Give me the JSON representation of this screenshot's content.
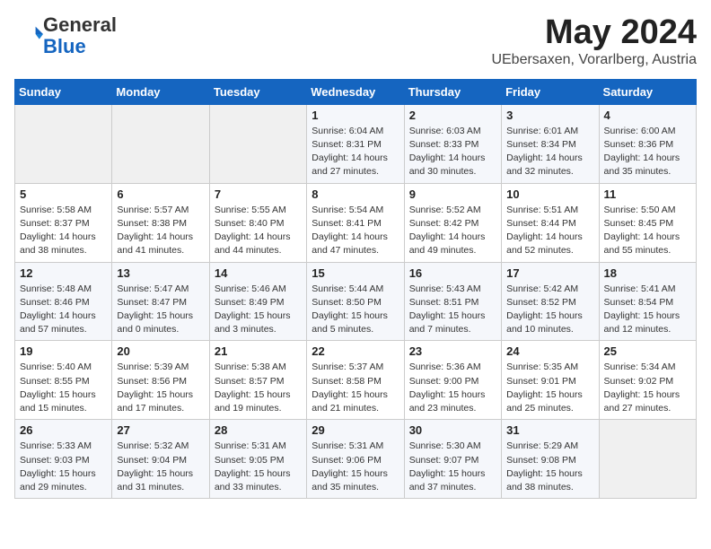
{
  "logo": {
    "general": "General",
    "blue": "Blue"
  },
  "title": "May 2024",
  "subtitle": "UEbersaxen, Vorarlberg, Austria",
  "days_of_week": [
    "Sunday",
    "Monday",
    "Tuesday",
    "Wednesday",
    "Thursday",
    "Friday",
    "Saturday"
  ],
  "weeks": [
    [
      {
        "day": "",
        "info": ""
      },
      {
        "day": "",
        "info": ""
      },
      {
        "day": "",
        "info": ""
      },
      {
        "day": "1",
        "info": "Sunrise: 6:04 AM\nSunset: 8:31 PM\nDaylight: 14 hours and 27 minutes."
      },
      {
        "day": "2",
        "info": "Sunrise: 6:03 AM\nSunset: 8:33 PM\nDaylight: 14 hours and 30 minutes."
      },
      {
        "day": "3",
        "info": "Sunrise: 6:01 AM\nSunset: 8:34 PM\nDaylight: 14 hours and 32 minutes."
      },
      {
        "day": "4",
        "info": "Sunrise: 6:00 AM\nSunset: 8:36 PM\nDaylight: 14 hours and 35 minutes."
      }
    ],
    [
      {
        "day": "5",
        "info": "Sunrise: 5:58 AM\nSunset: 8:37 PM\nDaylight: 14 hours and 38 minutes."
      },
      {
        "day": "6",
        "info": "Sunrise: 5:57 AM\nSunset: 8:38 PM\nDaylight: 14 hours and 41 minutes."
      },
      {
        "day": "7",
        "info": "Sunrise: 5:55 AM\nSunset: 8:40 PM\nDaylight: 14 hours and 44 minutes."
      },
      {
        "day": "8",
        "info": "Sunrise: 5:54 AM\nSunset: 8:41 PM\nDaylight: 14 hours and 47 minutes."
      },
      {
        "day": "9",
        "info": "Sunrise: 5:52 AM\nSunset: 8:42 PM\nDaylight: 14 hours and 49 minutes."
      },
      {
        "day": "10",
        "info": "Sunrise: 5:51 AM\nSunset: 8:44 PM\nDaylight: 14 hours and 52 minutes."
      },
      {
        "day": "11",
        "info": "Sunrise: 5:50 AM\nSunset: 8:45 PM\nDaylight: 14 hours and 55 minutes."
      }
    ],
    [
      {
        "day": "12",
        "info": "Sunrise: 5:48 AM\nSunset: 8:46 PM\nDaylight: 14 hours and 57 minutes."
      },
      {
        "day": "13",
        "info": "Sunrise: 5:47 AM\nSunset: 8:47 PM\nDaylight: 15 hours and 0 minutes."
      },
      {
        "day": "14",
        "info": "Sunrise: 5:46 AM\nSunset: 8:49 PM\nDaylight: 15 hours and 3 minutes."
      },
      {
        "day": "15",
        "info": "Sunrise: 5:44 AM\nSunset: 8:50 PM\nDaylight: 15 hours and 5 minutes."
      },
      {
        "day": "16",
        "info": "Sunrise: 5:43 AM\nSunset: 8:51 PM\nDaylight: 15 hours and 7 minutes."
      },
      {
        "day": "17",
        "info": "Sunrise: 5:42 AM\nSunset: 8:52 PM\nDaylight: 15 hours and 10 minutes."
      },
      {
        "day": "18",
        "info": "Sunrise: 5:41 AM\nSunset: 8:54 PM\nDaylight: 15 hours and 12 minutes."
      }
    ],
    [
      {
        "day": "19",
        "info": "Sunrise: 5:40 AM\nSunset: 8:55 PM\nDaylight: 15 hours and 15 minutes."
      },
      {
        "day": "20",
        "info": "Sunrise: 5:39 AM\nSunset: 8:56 PM\nDaylight: 15 hours and 17 minutes."
      },
      {
        "day": "21",
        "info": "Sunrise: 5:38 AM\nSunset: 8:57 PM\nDaylight: 15 hours and 19 minutes."
      },
      {
        "day": "22",
        "info": "Sunrise: 5:37 AM\nSunset: 8:58 PM\nDaylight: 15 hours and 21 minutes."
      },
      {
        "day": "23",
        "info": "Sunrise: 5:36 AM\nSunset: 9:00 PM\nDaylight: 15 hours and 23 minutes."
      },
      {
        "day": "24",
        "info": "Sunrise: 5:35 AM\nSunset: 9:01 PM\nDaylight: 15 hours and 25 minutes."
      },
      {
        "day": "25",
        "info": "Sunrise: 5:34 AM\nSunset: 9:02 PM\nDaylight: 15 hours and 27 minutes."
      }
    ],
    [
      {
        "day": "26",
        "info": "Sunrise: 5:33 AM\nSunset: 9:03 PM\nDaylight: 15 hours and 29 minutes."
      },
      {
        "day": "27",
        "info": "Sunrise: 5:32 AM\nSunset: 9:04 PM\nDaylight: 15 hours and 31 minutes."
      },
      {
        "day": "28",
        "info": "Sunrise: 5:31 AM\nSunset: 9:05 PM\nDaylight: 15 hours and 33 minutes."
      },
      {
        "day": "29",
        "info": "Sunrise: 5:31 AM\nSunset: 9:06 PM\nDaylight: 15 hours and 35 minutes."
      },
      {
        "day": "30",
        "info": "Sunrise: 5:30 AM\nSunset: 9:07 PM\nDaylight: 15 hours and 37 minutes."
      },
      {
        "day": "31",
        "info": "Sunrise: 5:29 AM\nSunset: 9:08 PM\nDaylight: 15 hours and 38 minutes."
      },
      {
        "day": "",
        "info": ""
      }
    ]
  ]
}
